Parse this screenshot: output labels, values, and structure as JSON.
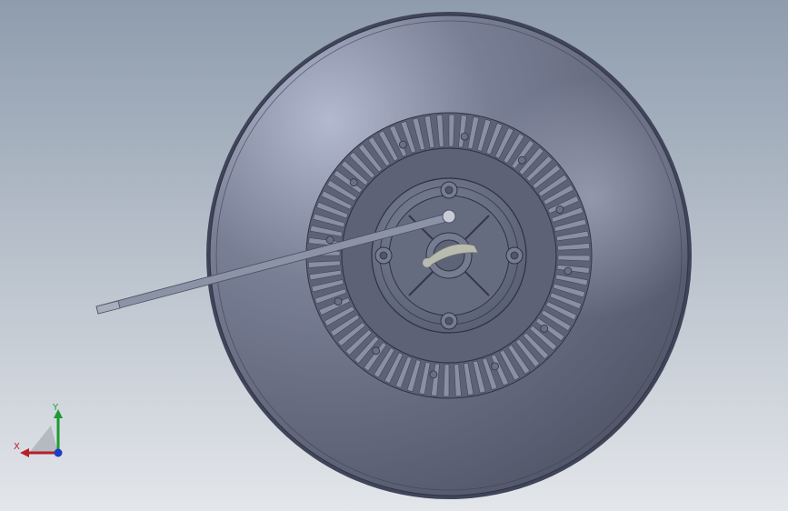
{
  "viewport": {
    "background_top": "#8e9cad",
    "background_bottom": "#e3e6ea"
  },
  "model": {
    "description_icon": "fan-clutch-housing-icon",
    "housing_color": "#797f95",
    "housing_highlight": "#b3b9cf",
    "housing_shadow": "#4d5264",
    "fin_color": "#8a90a3",
    "fin_dark": "#41465a",
    "rod_color": "#8d93a7",
    "shaft_color": "#b8bbb0",
    "fin_count": 72
  },
  "triad": {
    "x_label": "X",
    "y_label": "Y",
    "x_color": "#b81f2a",
    "y_color": "#1d9a33",
    "z_color": "#1f3cc8"
  }
}
